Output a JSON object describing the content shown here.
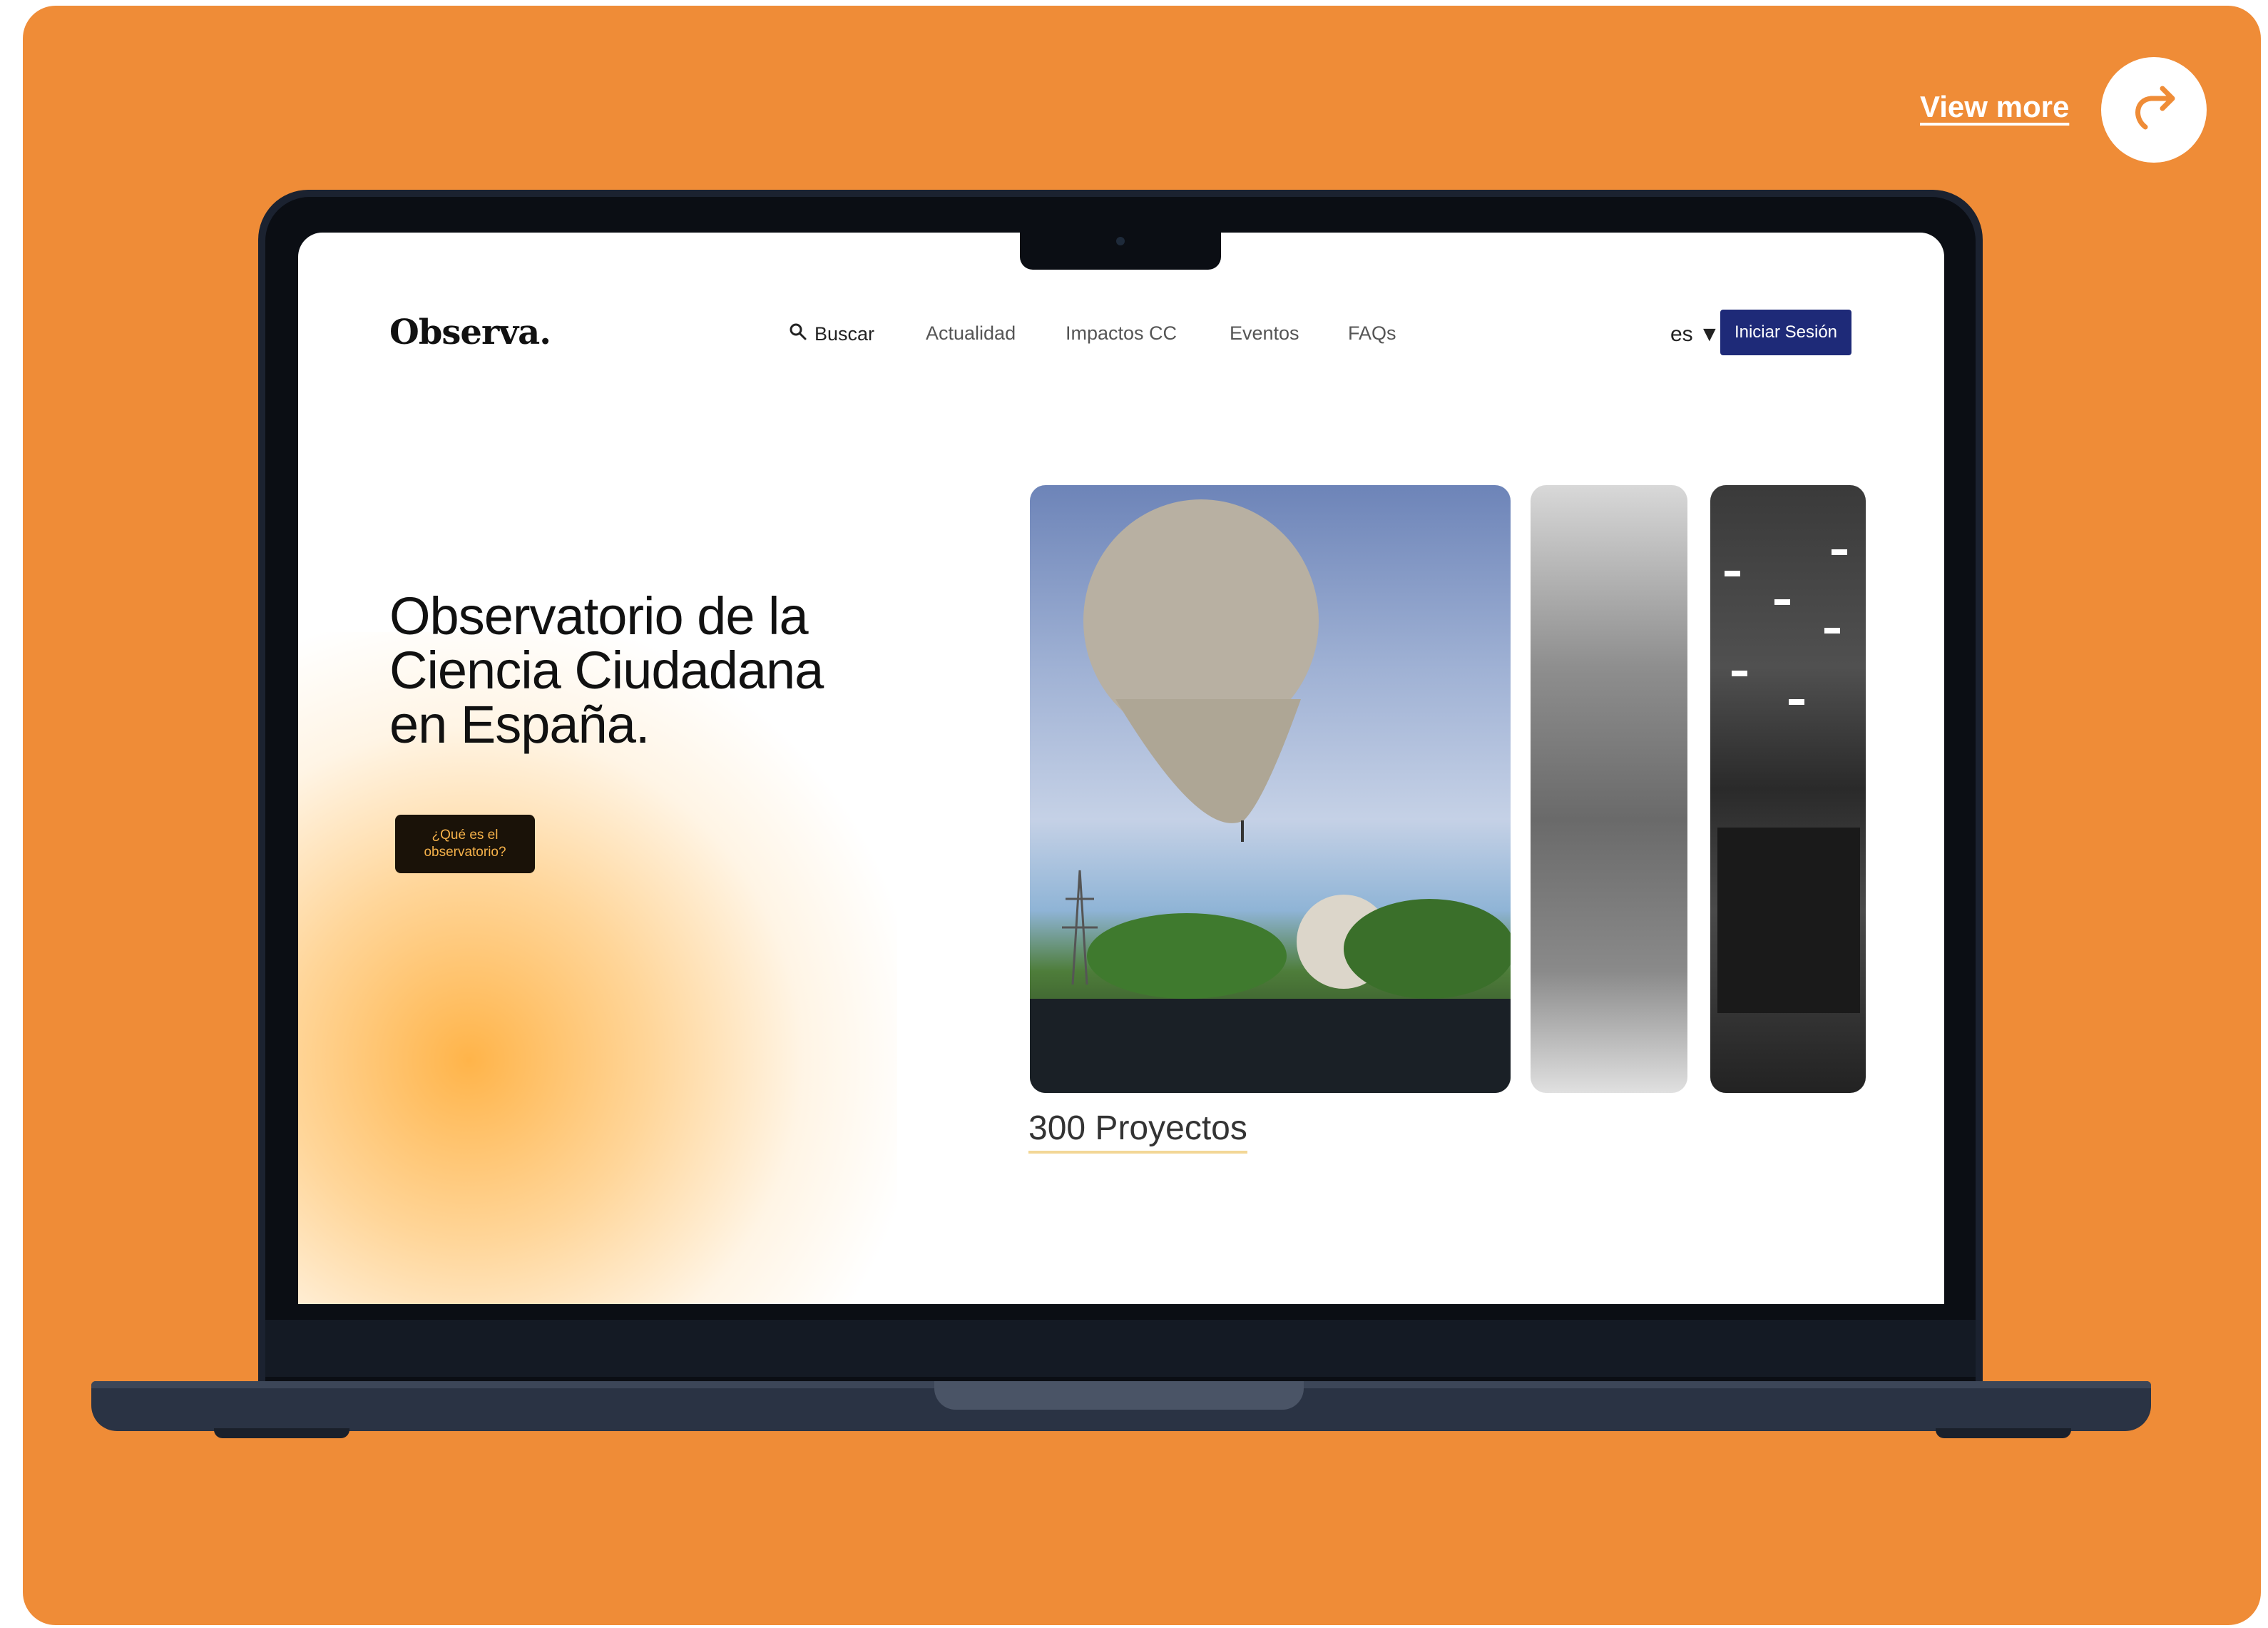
{
  "header": {
    "view_more": "View more"
  },
  "site": {
    "logo": "Observa.",
    "nav": {
      "search": "Buscar",
      "items": [
        "Actualidad",
        "Impactos CC",
        "Eventos",
        "FAQs"
      ]
    },
    "language": "es ▼",
    "login": "Iniciar Sesión",
    "hero_title": [
      "Observatorio de la",
      "Ciencia Ciudadana",
      "en España."
    ],
    "cta": "¿Qué es el\nobservatorio?",
    "caption": "300 Proyectos"
  },
  "colors": {
    "background": "#ef8c37",
    "login_button": "#1e2a78",
    "cta_text": "#f6b24a"
  },
  "icons": [
    "share-arrow-icon",
    "search-icon"
  ]
}
